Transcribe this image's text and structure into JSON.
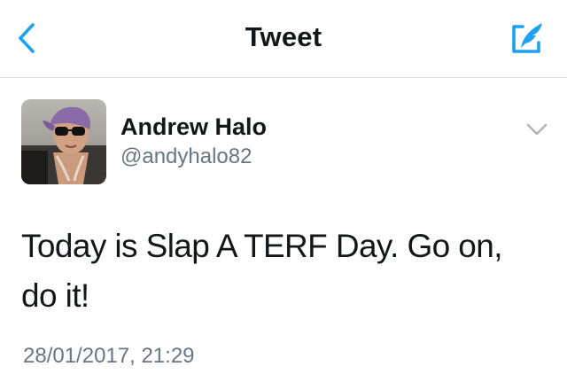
{
  "nav": {
    "title": "Tweet",
    "back_icon": "chevron-left-icon",
    "compose_icon": "compose-quill-icon",
    "accent_color": "#1da1f2"
  },
  "tweet": {
    "author": {
      "name": "Andrew Halo",
      "handle": "@andyhalo82",
      "avatar": "user-avatar-photo"
    },
    "menu_icon": "chevron-down-icon",
    "text": "Today is Slap A TERF Day. Go on, do it!",
    "timestamp": "28/01/2017, 21:29"
  },
  "colors": {
    "text_primary": "#14171a",
    "text_secondary": "#657786",
    "divider": "#d7dadd"
  }
}
